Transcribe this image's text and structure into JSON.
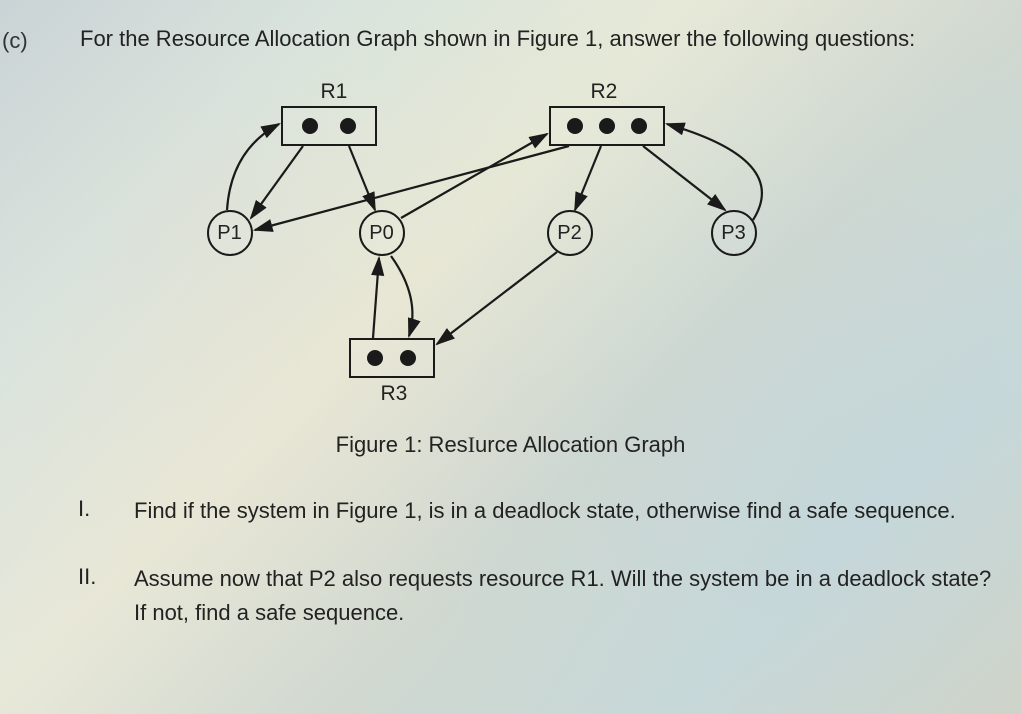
{
  "part_label": "(c)",
  "intro": "For the Resource Allocation Graph shown in Figure 1, answer the following questions:",
  "figure": {
    "resources": {
      "R1": {
        "label": "R1",
        "instances": 2
      },
      "R2": {
        "label": "R2",
        "instances": 3
      },
      "R3": {
        "label": "R3",
        "instances": 2
      }
    },
    "processes": {
      "P0": "P0",
      "P1": "P1",
      "P2": "P2",
      "P3": "P3"
    },
    "caption_prefix": "Figure 1: Res",
    "caption_suffix": "urce Allocation Graph"
  },
  "questions": [
    {
      "num": "I.",
      "text": "Find if the system in Figure 1, is in a deadlock state, otherwise find a safe sequence."
    },
    {
      "num": "II.",
      "text": "Assume now that P2 also requests resource R1. Will the system be in a deadlock state? If not, find a safe sequence."
    }
  ]
}
